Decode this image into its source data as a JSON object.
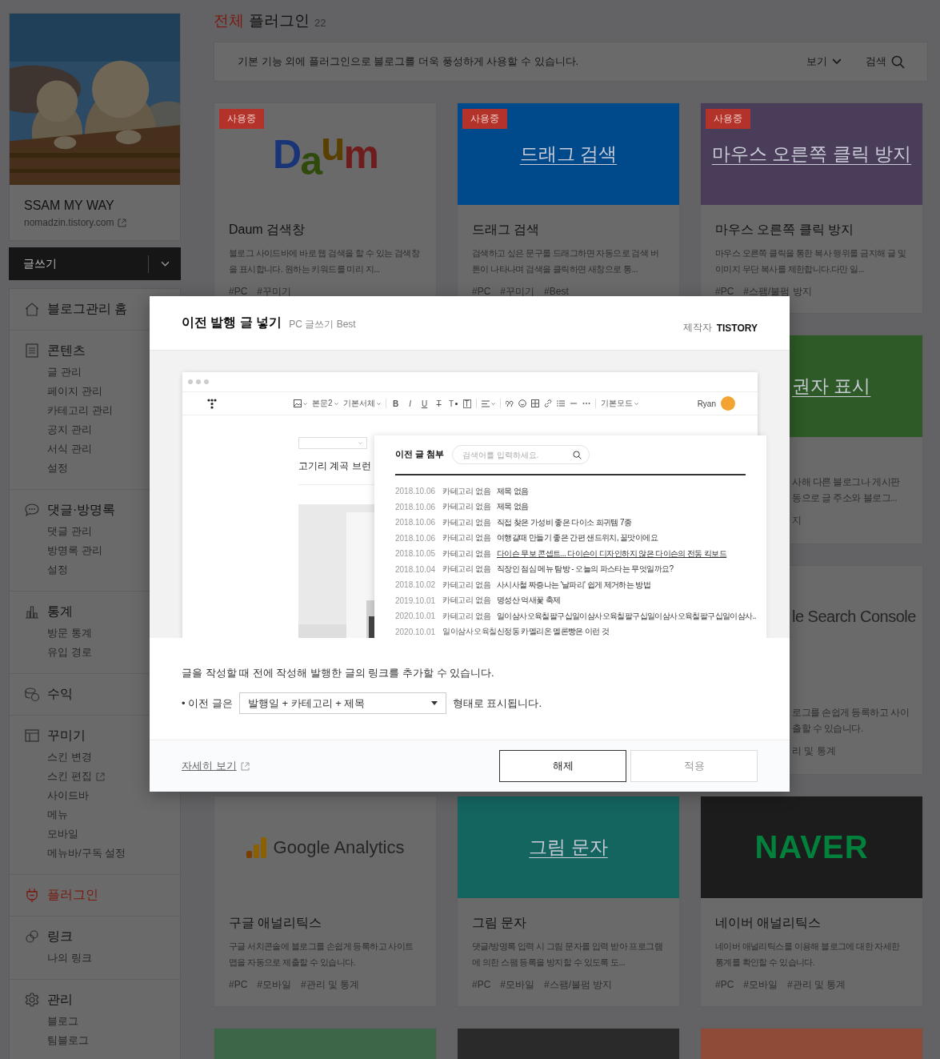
{
  "sidebar": {
    "blog": {
      "name": "SSAM MY WAY",
      "url": "nomadzin.tistory.com"
    },
    "write_button": "글쓰기",
    "sections": [
      {
        "title": "블로그관리 홈",
        "selected": false
      },
      {
        "title": "콘텐츠",
        "selected": false,
        "items": [
          {
            "label": "글 관리",
            "external": false
          },
          {
            "label": "페이지 관리",
            "external": false
          },
          {
            "label": "카테고리 관리",
            "external": false
          },
          {
            "label": "공지 관리",
            "external": false
          },
          {
            "label": "서식 관리",
            "external": false
          },
          {
            "label": "설정",
            "external": false
          }
        ]
      },
      {
        "title": "댓글·방명록",
        "selected": false,
        "items": [
          {
            "label": "댓글 관리",
            "external": false
          },
          {
            "label": "방명록 관리",
            "external": false
          },
          {
            "label": "설정",
            "external": false
          }
        ]
      },
      {
        "title": "통계",
        "selected": false,
        "items": [
          {
            "label": "방문 통계",
            "external": false
          },
          {
            "label": "유입 경로",
            "external": false
          }
        ]
      },
      {
        "title": "수익",
        "selected": false
      },
      {
        "title": "꾸미기",
        "selected": false,
        "items": [
          {
            "label": "스킨 변경",
            "external": false
          },
          {
            "label": "스킨 편집",
            "external": true
          },
          {
            "label": "사이드바",
            "external": false
          },
          {
            "label": "메뉴",
            "external": false
          },
          {
            "label": "모바일",
            "external": false
          },
          {
            "label": "메뉴바/구독 설정",
            "external": false
          }
        ]
      },
      {
        "title": "플러그인",
        "selected": true
      },
      {
        "title": "링크",
        "selected": false,
        "items": [
          {
            "label": "나의 링크",
            "external": false
          }
        ]
      },
      {
        "title": "관리",
        "selected": false,
        "items": [
          {
            "label": "블로그",
            "external": false
          },
          {
            "label": "팀블로그",
            "external": false
          }
        ]
      }
    ]
  },
  "main": {
    "filter": "전체",
    "title": "플러그인",
    "count": "22",
    "info": {
      "text": "기본 기능 외에 플러그인으로 블로그를 더욱 풍성하게 사용할 수 있습니다.",
      "view": "보기",
      "search": "검색"
    },
    "cards": [
      {
        "kind": "full",
        "badge": "사용중",
        "image": {
          "kind": "multicolor-wordmark",
          "text": "Daum",
          "color": "#6a6a6b"
        },
        "title": "Daum 검색창",
        "desc": "블로그 사이드바에 바로 웹 검색을 할 수 있는 검색창을 표시합니다. 원하는 키워드를 미리 지...",
        "tags": [
          "#PC",
          "#꾸미기"
        ]
      },
      {
        "kind": "full",
        "badge": "사용중",
        "image": {
          "kind": "banner",
          "text": "드래그 검색",
          "color": "#004a8c"
        },
        "title": "드래그 검색",
        "desc": "검색하고 싶은 문구를 드래그하면 자동으로 검색 버튼이 나타나며 검색을 클릭하면 새창으로 통...",
        "tags": [
          "#PC",
          "#꾸미기",
          "#Best"
        ]
      },
      {
        "kind": "full",
        "badge": "사용중",
        "image": {
          "kind": "banner",
          "text": "마우스 오른쪽 클릭 방지",
          "color": "#4a3d5a"
        },
        "title": "마우스 오른쪽 클릭 방지",
        "desc": "마우스 오른쪽 클릭을 통한 복사 행위를 금지해 글 및 이미지 무단 복사를 제한합니다.다만 일...",
        "tags": [
          "#PC",
          "#스팸/불펌 방지"
        ]
      },
      {
        "kind": "covered",
        "image": {
          "kind": "banner",
          "text": "권자 표시",
          "color": "#2d5a26"
        },
        "lines": [
          "사해 다른 블로그나 게시판",
          "동으로 글 주소와 블로그..."
        ],
        "tags": [
          "지"
        ]
      },
      {
        "kind": "covered",
        "image": {
          "kind": "wordmark",
          "text": "le Search Console",
          "color": "#6a6a6b"
        },
        "lines": [
          "로그를 손쉽게 등록하고 사이",
          "출할 수 있습니다."
        ],
        "tags": [
          "리 및 통계"
        ]
      },
      {
        "kind": "full",
        "image": {
          "kind": "bar-wordmark",
          "text": "Google Analytics",
          "color": "#6a6a6b"
        },
        "title": "구글 애널리틱스",
        "desc": "구글 서치콘솔에 블로그를 손쉽게 등록하고 사이트맵을 자동으로 제출할 수 있습니다.",
        "tags": [
          "#PC",
          "#모바일",
          "#관리 및 통계"
        ]
      },
      {
        "kind": "full",
        "image": {
          "kind": "banner",
          "text": "그림 문자",
          "color": "#146460"
        },
        "title": "그림 문자",
        "desc": "댓글/방명록 입력 시 그림 문자를 입력 받아 프로그램에 의한 스팸 등록을 방지할 수 있도록 도...",
        "tags": [
          "#PC",
          "#모바일",
          "#스팸/불펌 방지"
        ]
      },
      {
        "kind": "full",
        "image": {
          "kind": "bold-wordmark",
          "text": "NAVER",
          "color": "#1c1c1c"
        },
        "title": "네이버 애널리틱스",
        "desc": "네이버 애널리틱스를 이용해 블로그에 대한 자세한 통계를 확인할 수 있습니다.",
        "tags": [
          "#PC",
          "#모바일",
          "#관리 및 통계"
        ]
      },
      {
        "kind": "cut",
        "color": "#3d6547"
      },
      {
        "kind": "cut",
        "color": "#2a2a2a"
      },
      {
        "kind": "cut",
        "color": "#8f4a38"
      }
    ]
  },
  "modal": {
    "title": "이전 발행 글 넣기",
    "subtitle": "PC 글쓰기 Best",
    "maker_label": "제작자",
    "maker": "TISTORY",
    "preview": {
      "dropdowns": [
        "본문2",
        "기본서체"
      ],
      "format_buttons": [
        "B",
        "I",
        "U",
        "T",
        "T",
        "T"
      ],
      "mode": "기본모드",
      "user": "Ryan",
      "post_title": "고기리 계곡 브런",
      "panel": {
        "title": "이전 글 첨부",
        "placeholder": "검색어를 입력하세요.",
        "rows": [
          {
            "date": "2018.10.06",
            "category": "카테고리 없음",
            "title": "제목 없음",
            "hovered": false
          },
          {
            "date": "2018.10.06",
            "category": "카테고리 없음",
            "title": "제목 없음",
            "hovered": false
          },
          {
            "date": "2018.10.06",
            "category": "카테고리 없음",
            "title": "직접 찾은 가성비 좋은 다이소 희귀템 7종",
            "hovered": false
          },
          {
            "date": "2018.10.06",
            "category": "카테고리 없음",
            "title": "여행갈때 만들기 좋은 간편 샌드위치, 꿀맛이에요",
            "hovered": false
          },
          {
            "date": "2018.10.05",
            "category": "카테고리 없음",
            "title": "다이슨 무보 콘셉트... 다이슨이 디자인하지 않은 다이슨의 전동 킥보드",
            "hovered": true
          },
          {
            "date": "2018.10.04",
            "category": "카테고리 없음",
            "title": "직장인 점심 메뉴 탐방 - 오늘의 파스타는 무엇일까요?",
            "hovered": false
          },
          {
            "date": "2018.10.02",
            "category": "카테고리 없음",
            "title": "사시사철 짜증나는 '날파리' 쉽게 제거하는 방법",
            "hovered": false
          },
          {
            "date": "2019.10.01",
            "category": "카테고리 없음",
            "title": "명성산 억새꽃 축제",
            "hovered": false
          },
          {
            "date": "2020.10.01",
            "category": "카테고리 없음",
            "title": "일이삼사오육칠팔구십일이삼사오육칠팔구십일이삼사오육칠팔구십일이삼사..",
            "hovered": false
          },
          {
            "date": "2020.10.01",
            "category": "일이삼사오육칠",
            "title": "신정동 카멜리온 멜론빵은 이런 것",
            "hovered": false
          }
        ]
      }
    },
    "description": "글을 작성할 때 전에 작성해 발행한 글의 링크를 추가할 수 있습니다.",
    "option": {
      "label": "• 이전 글은",
      "value": "발행일 + 카테고리 + 제목",
      "suffix": "형태로 표시됩니다."
    },
    "link": "자세히 보기",
    "buttons": [
      {
        "label": "해제",
        "disabled": false
      },
      {
        "label": "적용",
        "disabled": true
      }
    ]
  }
}
